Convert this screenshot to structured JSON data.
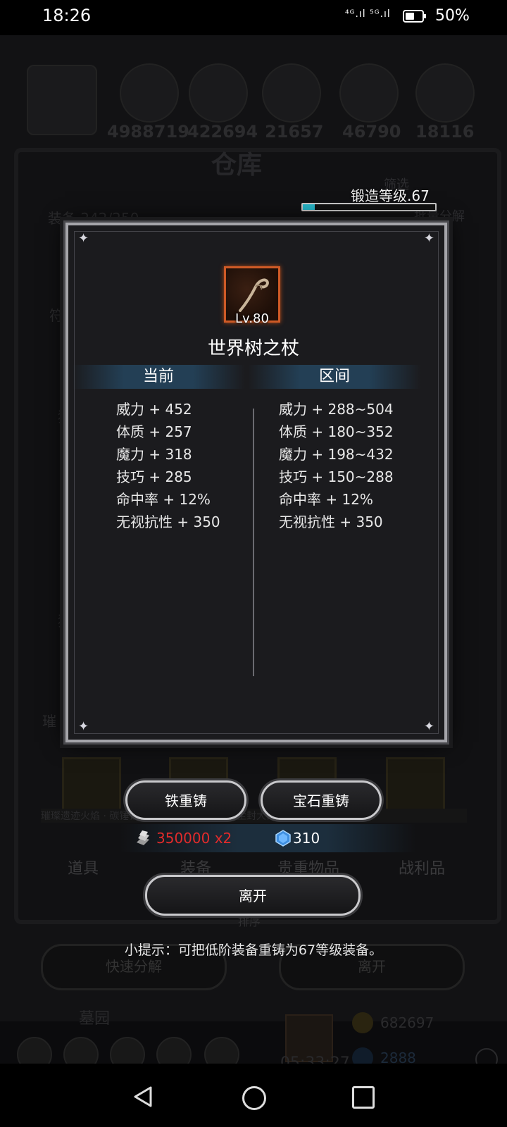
{
  "status_bar": {
    "time": "18:26",
    "signal": "⁴ᴳ.ıl ⁵ᴳ.ıl",
    "battery": "50%"
  },
  "background": {
    "resources": [
      "4988719",
      "422694",
      "21657",
      "46790",
      "18116"
    ],
    "title": "仓库",
    "capacity": "装备 242/250",
    "filter_label": "筛选",
    "decompose_label": "批量分解",
    "side_labels": [
      "符",
      "猪",
      "猪",
      "璀"
    ],
    "slot_strip_text": "璀璨遗迹火焰 · 碳锤铜质镰盾 · 炼铸形魔杖 · 尘封大剑",
    "tabs": [
      "道具",
      "装备",
      "贵重物品",
      "战利品"
    ],
    "sort_label": "排序",
    "quick_decompose": "快速分解",
    "leave": "离开",
    "camp": "墓园",
    "timer": "05:33:27",
    "gold": "682697",
    "gems": "2888"
  },
  "forge": {
    "level_label": "锻造等级.67",
    "progress": 0.09
  },
  "item": {
    "level": "Lv.80",
    "name": "世界树之杖",
    "icon": "staff-icon"
  },
  "columns": {
    "current_header": "当前",
    "range_header": "区间"
  },
  "current_stats": [
    "威力 + 452",
    "体质 + 257",
    "魔力 + 318",
    "技巧 + 285",
    "命中率 + 12%",
    "无视抗性 + 350"
  ],
  "range_stats": [
    "威力 + 288~504",
    "体质 + 180~352",
    "魔力 + 198~432",
    "技巧 + 150~288",
    "命中率 + 12%",
    "无视抗性 + 350"
  ],
  "buttons": {
    "iron_reforge": "铁重铸",
    "gem_reforge": "宝石重铸",
    "leave": "离开"
  },
  "costs": {
    "iron": "350000 x2",
    "gems": "310"
  },
  "tip": "小提示：可把低阶装备重铸为67等级装备。",
  "colors": {
    "accent": "#27b4c6",
    "item_frame": "#ce5a26",
    "cost_warning": "#e22b2b"
  }
}
